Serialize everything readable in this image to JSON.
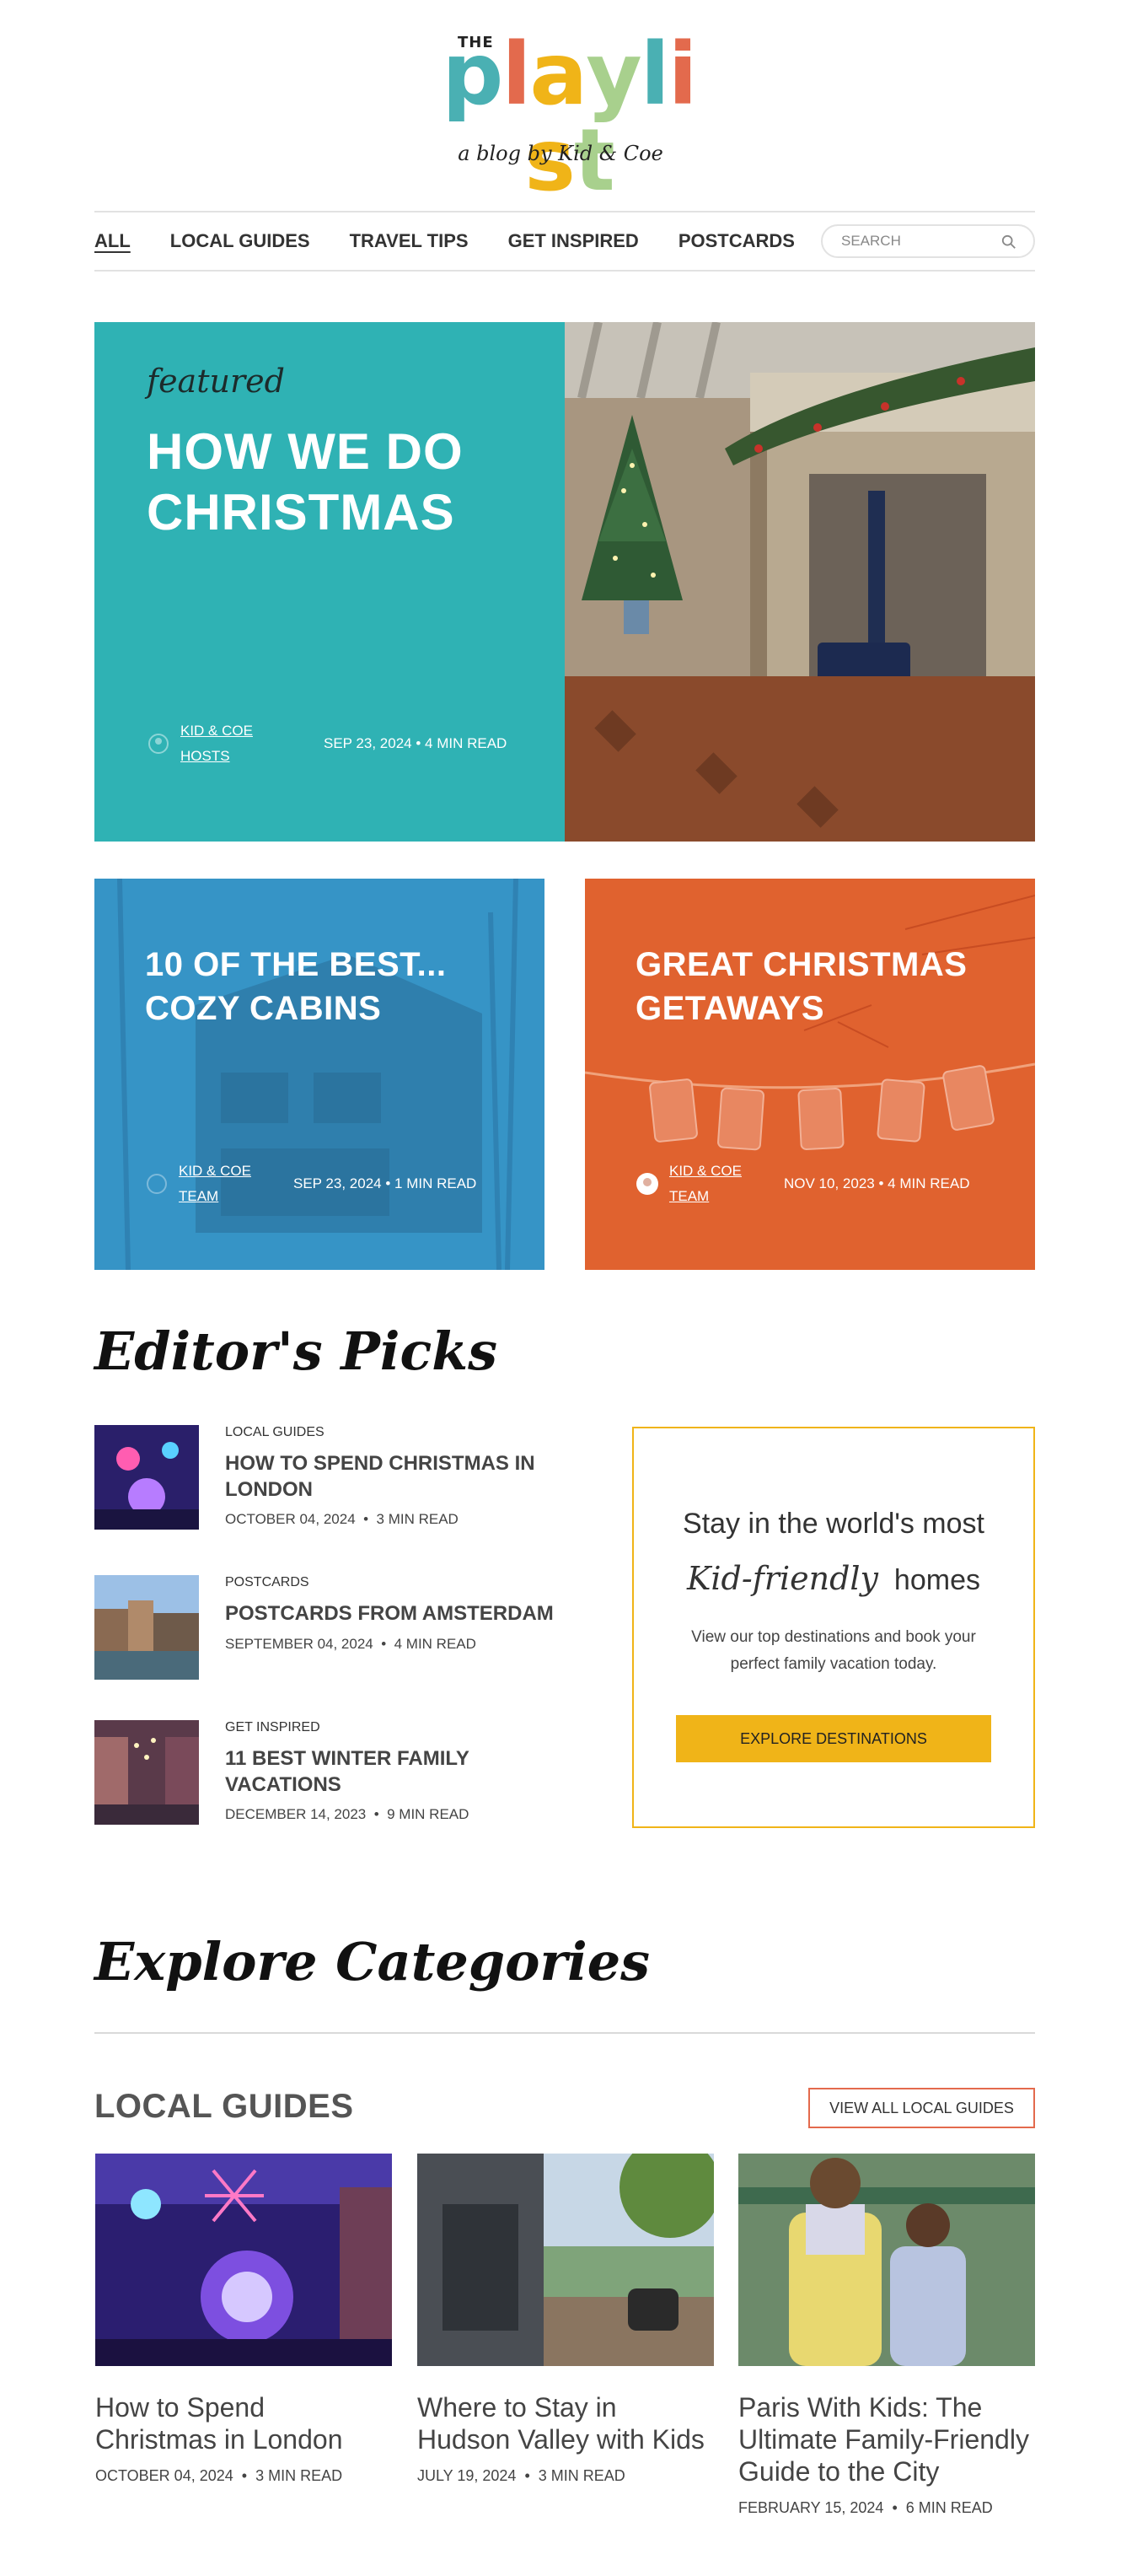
{
  "logo": {
    "the": "THE",
    "letters": [
      {
        "ch": "p",
        "color": "#4ab0b3"
      },
      {
        "ch": "l",
        "color": "#e36a4d"
      },
      {
        "ch": "a",
        "color": "#f0b418"
      },
      {
        "ch": "y",
        "color": "#a8d08d"
      },
      {
        "ch": "l",
        "color": "#4ab0b3"
      },
      {
        "ch": "i",
        "color": "#e36a4d"
      },
      {
        "ch": "s",
        "color": "#f0b418"
      },
      {
        "ch": "t",
        "color": "#a8d08d"
      }
    ],
    "tagline": "a blog by Kid & Coe"
  },
  "nav": {
    "items": [
      "ALL",
      "LOCAL GUIDES",
      "TRAVEL TIPS",
      "GET INSPIRED",
      "POSTCARDS"
    ],
    "search_placeholder": "SEARCH"
  },
  "featured": {
    "kicker": "featured",
    "title": "HOW WE DO CHRISTMAS",
    "author": "KID & COE HOSTS",
    "date": "SEP 23, 2024",
    "read": "4 MIN READ",
    "color": "#2fb2b4"
  },
  "cards": [
    {
      "title": "10 OF THE BEST... COZY CABINS",
      "author": "KID & COE TEAM",
      "date": "SEP 23, 2024",
      "read": "1 MIN READ",
      "color": "#3694c6"
    },
    {
      "title": "GREAT CHRISTMAS GETAWAYS",
      "author": "KID & COE TEAM",
      "date": "NOV 10, 2023",
      "read": "4 MIN READ",
      "color": "#e0622f"
    }
  ],
  "editors_picks": {
    "heading": "Editor's Picks",
    "items": [
      {
        "category": "LOCAL GUIDES",
        "title": "HOW TO SPEND CHRISTMAS IN LONDON",
        "date": "OCTOBER 04, 2024",
        "read": "3 MIN READ"
      },
      {
        "category": "POSTCARDS",
        "title": "POSTCARDS FROM AMSTERDAM",
        "date": "SEPTEMBER 04, 2024",
        "read": "4 MIN READ"
      },
      {
        "category": "GET INSPIRED",
        "title": "11 BEST WINTER FAMILY VACATIONS",
        "date": "DECEMBER 14, 2023",
        "read": "9 MIN READ"
      }
    ]
  },
  "promo": {
    "line1": "Stay in the world's most",
    "script": "Kid-friendly",
    "line2_rest": "homes",
    "body": "View our top destinations and book your perfect family vacation today.",
    "button": "EXPLORE DESTINATIONS",
    "accent": "#f0b418"
  },
  "categories": {
    "heading": "Explore Categories",
    "section_title": "LOCAL GUIDES",
    "view_all": "VIEW ALL LOCAL GUIDES",
    "posts": [
      {
        "title": "How to Spend Christmas in London",
        "date": "OCTOBER 04, 2024",
        "read": "3 MIN READ"
      },
      {
        "title": "Where to Stay in Hudson Valley with Kids",
        "date": "JULY 19, 2024",
        "read": "3 MIN READ"
      },
      {
        "title": "Paris With Kids: The Ultimate Family-Friendly Guide to the City",
        "date": "FEBRUARY 15, 2024",
        "read": "6 MIN READ"
      }
    ]
  },
  "meta_separator": "•"
}
